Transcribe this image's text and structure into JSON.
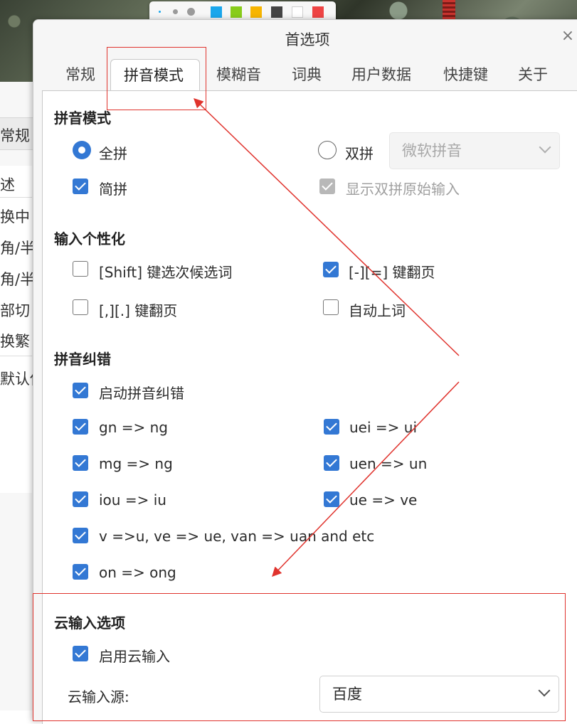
{
  "back_window": {
    "items": [
      "常规",
      "述",
      "换中",
      "角/半",
      "角/半",
      "部切",
      "换繁",
      "默认使"
    ]
  },
  "toolbar": {
    "colors": [
      "#1aa7ec",
      "#88cc1a",
      "#f7b500",
      "#444444",
      "#ffffff",
      "#ee4444"
    ]
  },
  "dialog": {
    "title": "首选项",
    "close": "×"
  },
  "tabs": [
    {
      "label": "常规"
    },
    {
      "label": "拼音模式"
    },
    {
      "label": "模糊音"
    },
    {
      "label": "词典"
    },
    {
      "label": "用户数据"
    },
    {
      "label": "快捷键"
    },
    {
      "label": "关于"
    }
  ],
  "pinyin_mode": {
    "title": "拼音模式",
    "full_pinyin": "全拼",
    "double_pinyin": "双拼",
    "scheme": "微软拼音",
    "abbr": "简拼",
    "show_original": "显示双拼原始输入"
  },
  "personalize": {
    "title": "输入个性化",
    "shift_select": "[Shift] 键选次候选词",
    "minus_equal_page": "[-][=] 键翻页",
    "comma_period_page": "[,][.] 键翻页",
    "auto_commit": "自动上词"
  },
  "correction": {
    "title": "拼音纠错",
    "enable": "启动拼音纠错",
    "gn": "gn => ng",
    "uei": "uei => ui",
    "mg": "mg => ng",
    "uen": "uen => un",
    "iou": "iou => iu",
    "ue": "ue => ve",
    "v": "v =>u, ve => ue, van => uan and etc",
    "on": "on => ong"
  },
  "cloud": {
    "title": "云输入选项",
    "enable": "启用云输入",
    "source_label": "云输入源:",
    "source_value": "百度"
  },
  "accent": {
    "blue": "#3378d4",
    "annotation_red": "#e0332d"
  }
}
